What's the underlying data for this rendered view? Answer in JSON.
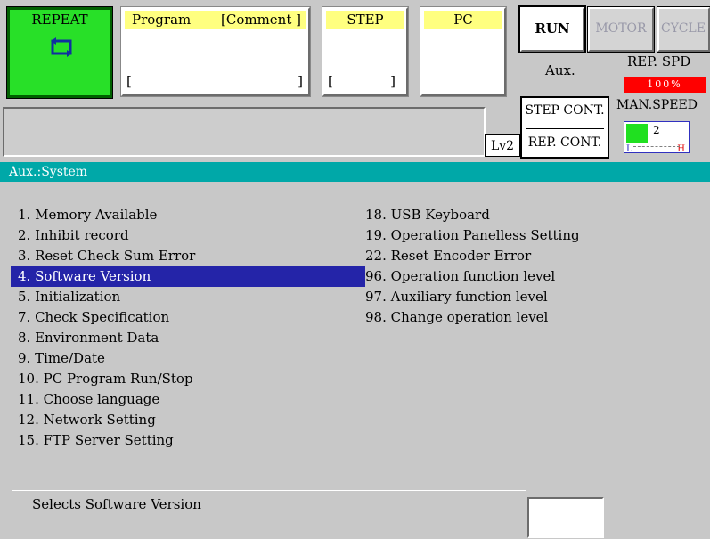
{
  "top": {
    "repeat_label": "REPEAT",
    "program_label": "Program",
    "comment_label": "[Comment ]",
    "program_bracket_open": "[",
    "program_bracket_close": "]",
    "step_label": "STEP",
    "step_bracket_open": "[",
    "step_bracket_close": "]",
    "pc_label": "PC",
    "run_label": "RUN",
    "motor_label": "MOTOR",
    "cycle_label": "CYCLE",
    "aux_label": "Aux.",
    "rep_spd_label": "REP. SPD",
    "rep_spd_value": "100%",
    "step_cont_label": "STEP CONT.",
    "rep_cont_label": "REP. CONT.",
    "man_speed_label": "MAN.SPEED",
    "man_speed_value": "2",
    "man_speed_low": "L",
    "man_speed_high": "H",
    "level_label": "Lv2"
  },
  "section": {
    "title": "Aux.:System"
  },
  "menu": {
    "left": [
      "1. Memory Available",
      "2. Inhibit record",
      "3. Reset Check Sum Error",
      "4. Software Version",
      "5. Initialization",
      "7. Check Specification",
      "8. Environment Data",
      "9. Time/Date",
      "10. PC Program Run/Stop",
      "11. Choose language",
      "12. Network Setting",
      "15. FTP Server Setting"
    ],
    "right": [
      "18. USB Keyboard",
      "19. Operation Panelless Setting",
      "22. Reset Encoder Error",
      "96. Operation function level",
      "97. Auxiliary function level",
      "98. Change operation level"
    ],
    "selected_index": 3
  },
  "status": {
    "message": "Selects Software Version"
  },
  "colors": {
    "accent": "#00a8a8",
    "selection": "#2424a8",
    "repeat_bg": "#28e028",
    "panel_header": "#ffff80",
    "speed_bar": "#ff0000"
  }
}
